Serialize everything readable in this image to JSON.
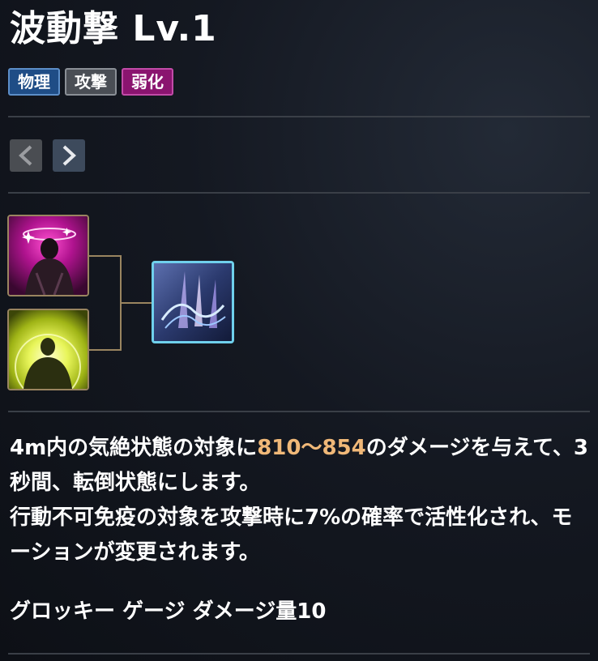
{
  "skill": {
    "name": "波動撃",
    "level": "Lv.1"
  },
  "tags": [
    {
      "label": "物理",
      "bg": "#1f4d86",
      "border": "#5c8ec8"
    },
    {
      "label": "攻撃",
      "bg": "#4a4e55",
      "border": "#8a8f96"
    },
    {
      "label": "弱化",
      "bg": "#8a146f",
      "border": "#c24ba8"
    }
  ],
  "icons": {
    "prev": "chevron-left-icon",
    "next": "chevron-right-icon",
    "prereq_1": "stun-skill-icon",
    "prereq_2": "radiant-aura-skill-icon",
    "current": "shockwave-skill-icon"
  },
  "description": {
    "part1": "4m内の気絶状態の対象に",
    "damage": "810～854",
    "part2": "のダメージを与えて、3秒間、転倒状態にします。",
    "line2": "行動不可免疫の対象を攻撃時に7%の確率で活性化され、モーションが変更されます。"
  },
  "stat": "グロッキー ゲージ ダメージ量10",
  "colors": {
    "highlight": "#f0b878",
    "frame_gold": "#9a8560",
    "frame_selected": "#6fd0ec"
  }
}
